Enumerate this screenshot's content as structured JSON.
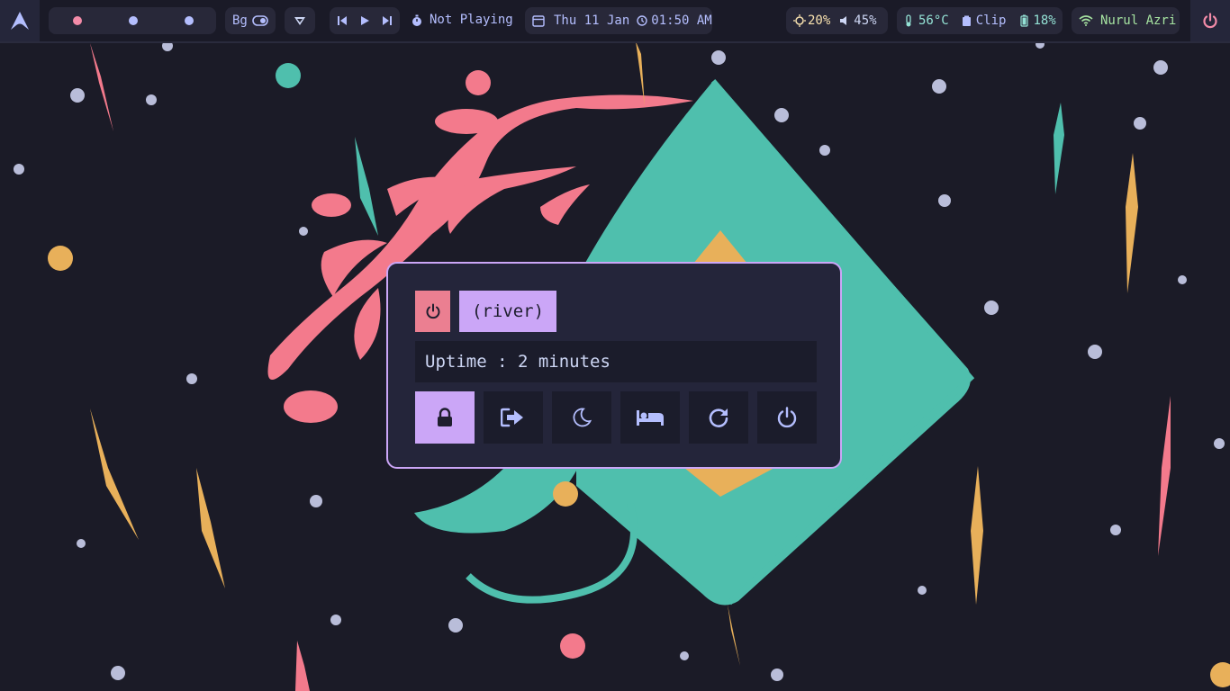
{
  "topbar": {
    "launcher": {
      "icon": "arch-logo-icon"
    },
    "workspaces": [
      {
        "icon": "workspace-dot-icon",
        "color": "#f38ba8"
      },
      {
        "icon": "workspace-dot-icon",
        "color": "#b4befe"
      },
      {
        "icon": "workspace-dot-icon",
        "color": "#b4befe"
      }
    ],
    "bg_toggle": {
      "label": "Bg",
      "icon": "toggle-icon"
    },
    "wallpaper_icon": "wallpaper-icon",
    "media": {
      "status": "Not Playing",
      "icons": [
        "previous-icon",
        "play-icon",
        "next-icon",
        "timer-icon"
      ]
    },
    "datetime": {
      "date": "Thu 11 Jan",
      "time": "01:50 AM"
    },
    "brightness": "20%",
    "volume": "45%",
    "temperature": "56°C",
    "clipboard": "Clip",
    "battery": "18%",
    "network": "Nurul Azri",
    "power_icon": "power-icon"
  },
  "dialog": {
    "session": "(river)",
    "uptime": "Uptime : 2 minutes",
    "actions": [
      {
        "name": "lock",
        "icon": "lock-icon",
        "active": true
      },
      {
        "name": "logout",
        "icon": "logout-icon",
        "active": false
      },
      {
        "name": "suspend",
        "icon": "moon-icon",
        "active": false
      },
      {
        "name": "hibernate",
        "icon": "bed-icon",
        "active": false
      },
      {
        "name": "reboot",
        "icon": "reboot-icon",
        "active": false
      },
      {
        "name": "shutdown",
        "icon": "power-icon",
        "active": false
      }
    ]
  },
  "colors": {
    "base": "#1e1e2e",
    "accent": "#cba6f7",
    "pink": "#f38ba8",
    "teal": "#4fbfad",
    "yellow": "#e8b05a",
    "lavender": "#b4befe"
  }
}
